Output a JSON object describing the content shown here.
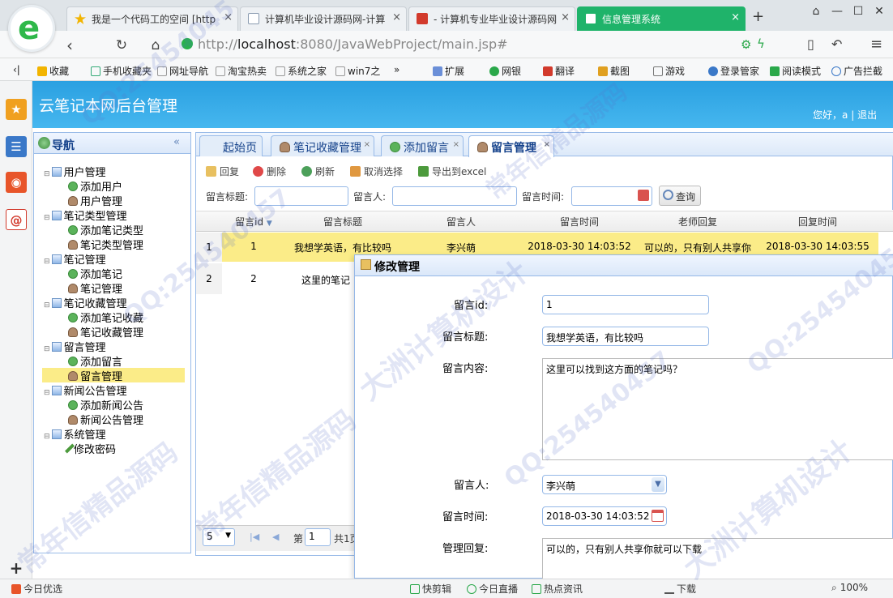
{
  "browser": {
    "tabs": [
      {
        "label": "我是一个代码工的空间 [http",
        "icon_color": "#f2b400"
      },
      {
        "label": "计算机毕业设计源码网-计算",
        "icon_color": "#8a9bb0"
      },
      {
        "label": "- 计算机专业毕业设计源码网",
        "icon_color": "#d23a2c"
      },
      {
        "label": "信息管理系统",
        "icon_color": "#ffffff"
      }
    ],
    "new_tab": "+",
    "url_host": "localhost",
    "url_rest": ":8080/JavaWebProject/main.jsp#",
    "url_scheme": "http://",
    "bookmarks": [
      "收藏",
      "手机收藏夹",
      "网址导航",
      "淘宝热卖",
      "系统之家",
      "win7之"
    ],
    "bookmarks_more": "»",
    "extensions": [
      "扩展",
      "网银",
      "翻译",
      "截图",
      "游戏",
      "登录管家",
      "阅读模式",
      "广告拦截"
    ]
  },
  "app": {
    "title": "云笔记本网后台管理",
    "greeting": "您好，a",
    "separator": "|",
    "logout": "退出",
    "nav_title": "导航",
    "nav_collapse": "«",
    "nav": [
      {
        "label": "用户管理",
        "children": [
          "添加用户",
          "用户管理"
        ]
      },
      {
        "label": "笔记类型管理",
        "children": [
          "添加笔记类型",
          "笔记类型管理"
        ]
      },
      {
        "label": "笔记管理",
        "children": [
          "添加笔记",
          "笔记管理"
        ]
      },
      {
        "label": "笔记收藏管理",
        "children": [
          "添加笔记收藏",
          "笔记收藏管理"
        ]
      },
      {
        "label": "留言管理",
        "children": [
          "添加留言",
          "留言管理"
        ]
      },
      {
        "label": "新闻公告管理",
        "children": [
          "添加新闻公告",
          "新闻公告管理"
        ]
      },
      {
        "label": "系统管理",
        "children": [
          "修改密码"
        ]
      }
    ],
    "tabs": [
      "起始页",
      "笔记收藏管理",
      "添加留言",
      "留言管理"
    ],
    "tab_close": "×",
    "toolbar": [
      "回复",
      "删除",
      "刷新",
      "取消选择",
      "导出到excel"
    ],
    "search": {
      "title_label": "留言标题:",
      "person_label": "留言人:",
      "time_label": "留言时间:",
      "button": "查询"
    },
    "grid": {
      "columns": [
        "留言id",
        "留言标题",
        "留言人",
        "留言时间",
        "老师回复",
        "回复时间"
      ],
      "rows": [
        {
          "num": "1",
          "id": "1",
          "title": "我想学英语，有比较吗",
          "person": "李兴萌",
          "time": "2018-03-30 14:03:52",
          "reply": "可以的，只有别人共享你",
          "reply_time": "2018-03-30 14:03:55"
        },
        {
          "num": "2",
          "id": "2",
          "title": "这里的笔记"
        }
      ]
    },
    "pager": {
      "page_size": "5",
      "page_label": "第",
      "page": "1",
      "total": "共1页"
    },
    "modal": {
      "title": "修改管理",
      "id_label": "留言id:",
      "id_value": "1",
      "title_label": "留言标题:",
      "title_value": "我想学英语，有比较吗",
      "content_label": "留言内容:",
      "content_value": "这里可以找到这方面的笔记吗？",
      "person_label": "留言人:",
      "person_value": "李兴萌",
      "time_label": "留言时间:",
      "time_value": "2018-03-30 14:03:52",
      "reply_label": "管理回复:",
      "reply_value": "可以的，只有别人共享你就可以下载"
    }
  },
  "statusbar": {
    "left": "今日优选",
    "items": [
      "快剪辑",
      "今日直播",
      "热点资讯",
      "下载"
    ],
    "zoom": "100%"
  },
  "watermarks": [
    "QQ:25454045",
    "常年信精品源码",
    "大洲计算机设计",
    "QQ:254540457",
    "常年信精品源码",
    "QQ:254540457",
    "大洲计算机设计",
    "常年信精品源码",
    "QQ:254540457"
  ],
  "colors": {
    "header": "#2aa0e1",
    "active_tab": "#1fb36a",
    "selected_row": "#fbec88"
  }
}
